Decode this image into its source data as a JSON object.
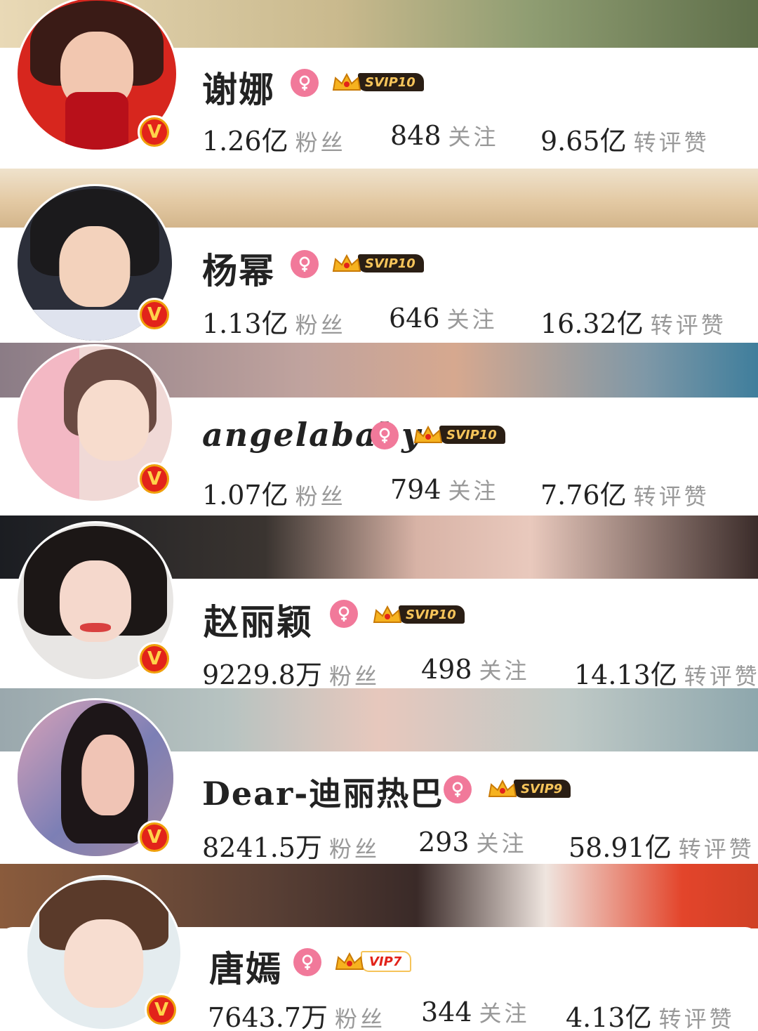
{
  "profiles": [
    {
      "name": "谢娜",
      "vip": "SVIP10",
      "fans": "1.26亿",
      "fans_label": "粉丝",
      "follow": "848",
      "follow_label": "关注",
      "likes": "9.65亿",
      "likes_label": "转评赞",
      "verified_badge": "V"
    },
    {
      "name": "杨幂",
      "vip": "SVIP10",
      "fans": "1.13亿",
      "fans_label": "粉丝",
      "follow": "646",
      "follow_label": "关注",
      "likes": "16.32亿",
      "likes_label": "转评赞",
      "verified_badge": "V"
    },
    {
      "name": "angelababy",
      "vip": "SVIP10",
      "fans": "1.07亿",
      "fans_label": "粉丝",
      "follow": "794",
      "follow_label": "关注",
      "likes": "7.76亿",
      "likes_label": "转评赞",
      "verified_badge": "V"
    },
    {
      "name": "赵丽颖",
      "vip": "SVIP10",
      "fans": "9229.8万",
      "fans_label": "粉丝",
      "follow": "498",
      "follow_label": "关注",
      "likes": "14.13亿",
      "likes_label": "转评赞",
      "verified_badge": "V"
    },
    {
      "name": "Dear-迪丽热巴",
      "vip": "SVIP9",
      "fans": "8241.5万",
      "fans_label": "粉丝",
      "follow": "293",
      "follow_label": "关注",
      "likes": "58.91亿",
      "likes_label": "转评赞",
      "verified_badge": "V"
    },
    {
      "name": "唐嫣",
      "vip": "VIP7",
      "fans": "7643.7万",
      "fans_label": "粉丝",
      "follow": "344",
      "follow_label": "关注",
      "likes": "4.13亿",
      "likes_label": "转评赞",
      "verified_badge": "V"
    }
  ],
  "icons": {
    "gender": "female-icon",
    "vip": "crown-icon",
    "verified": "verified-v-icon"
  },
  "colors": {
    "gender_pink": "#f1799a",
    "badge_red": "#e2231a",
    "badge_gold": "#f0a00c",
    "vip_dark": "#2a1e14",
    "vip_gold": "#f6c45a"
  }
}
